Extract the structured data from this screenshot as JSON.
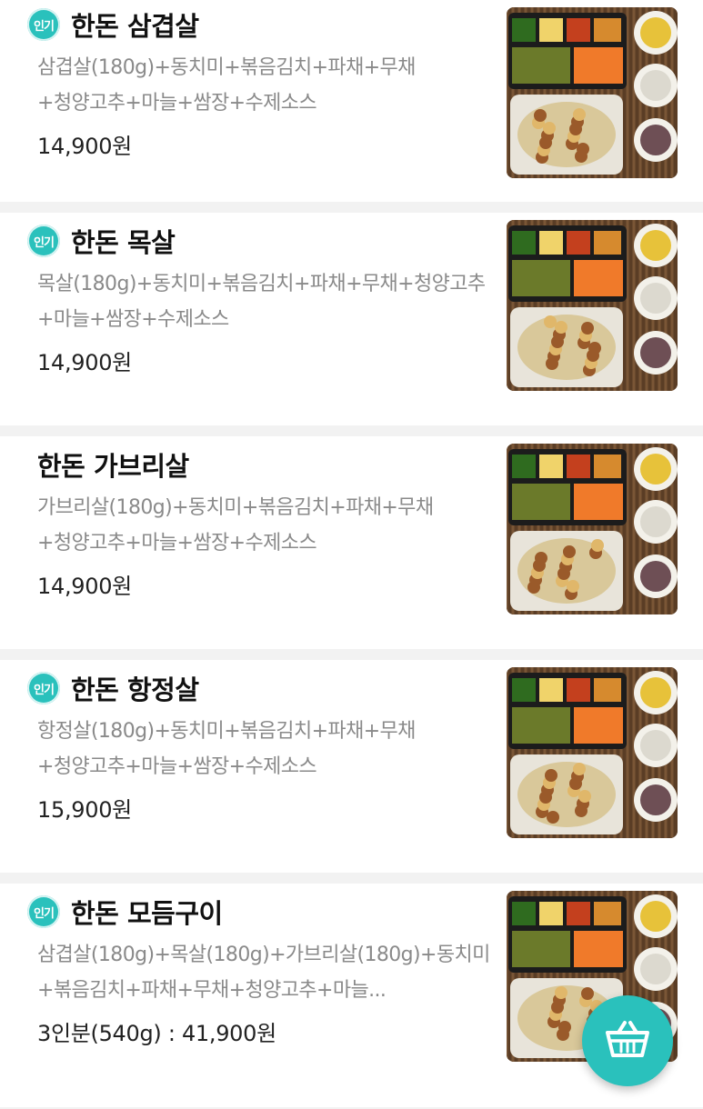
{
  "menu": {
    "items": [
      {
        "popular": true,
        "badge": "인기",
        "title": "한돈 삼겹살",
        "description": "삼겹살(180g)+동치미+볶음김치+파채+무채+청양고추+마늘+쌈장+수제소스",
        "price": "14,900원"
      },
      {
        "popular": true,
        "badge": "인기",
        "title": "한돈 목살",
        "description": "목살(180g)+동치미+볶음김치+파채+무채+청양고추+마늘+쌈장+수제소스",
        "price": "14,900원"
      },
      {
        "popular": false,
        "badge": "",
        "title": "한돈 가브리살",
        "description": "가브리살(180g)+동치미+볶음김치+파채+무채+청양고추+마늘+쌈장+수제소스",
        "price": "14,900원"
      },
      {
        "popular": true,
        "badge": "인기",
        "title": "한돈 항정살",
        "description": "항정살(180g)+동치미+볶음김치+파채+무채+청양고추+마늘+쌈장+수제소스",
        "price": "15,900원"
      },
      {
        "popular": true,
        "badge": "인기",
        "title": "한돈 모듬구이",
        "description": "삼겹살(180g)+목살(180g)+가브리살(180g)+동치미+볶음김치+파채+무채+청양고추+마늘...",
        "price": "3인분(540g) : 41,900원"
      }
    ]
  },
  "cart_button": {
    "icon": "basket-icon"
  },
  "colors": {
    "accent": "#2ac1bc",
    "price_text": "#222222",
    "desc_text": "#8a8a8a"
  }
}
